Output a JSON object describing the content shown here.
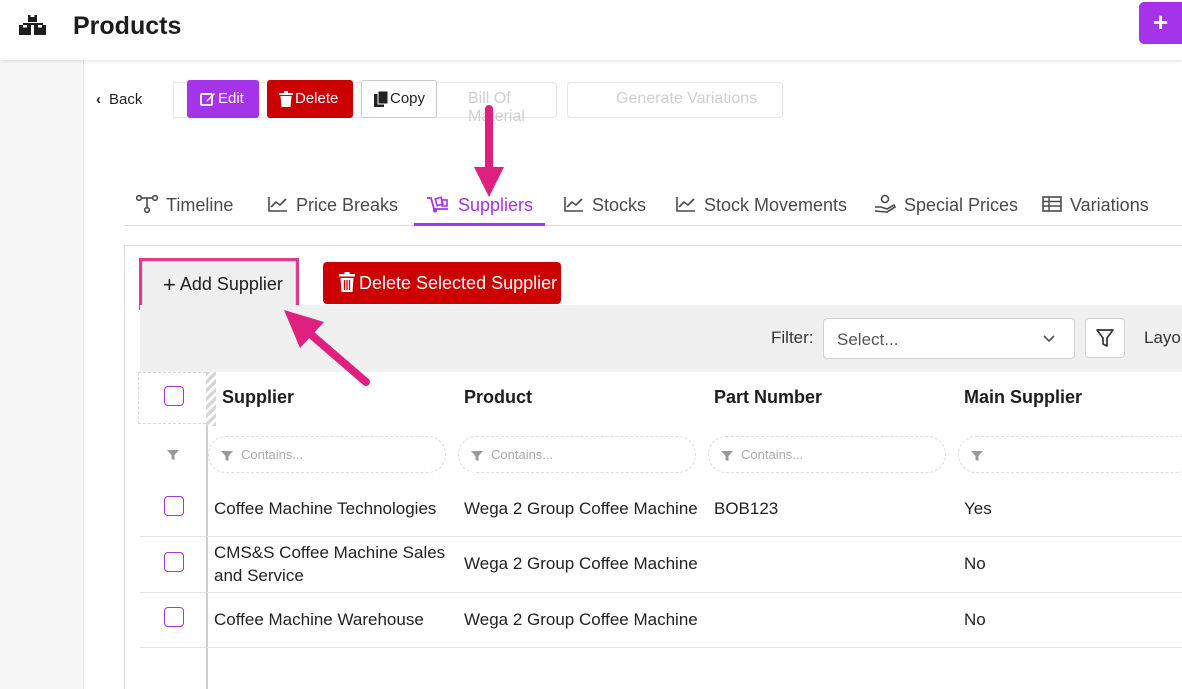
{
  "header": {
    "title": "Products",
    "add_button_label": "+ "
  },
  "toolbar": {
    "back_label": "Back",
    "edit_label": "Edit",
    "delete_label": "Delete",
    "copy_label": "Copy",
    "ghost_text_1": "Bill Of Material",
    "ghost_text_2": "Generate Variations"
  },
  "tabs": [
    {
      "label": "Timeline",
      "icon": "timeline-icon"
    },
    {
      "label": "Price Breaks",
      "icon": "chart-line-icon"
    },
    {
      "label": "Suppliers",
      "icon": "hand-truck-icon",
      "active": true
    },
    {
      "label": "Stocks",
      "icon": "chart-line-icon"
    },
    {
      "label": "Stock Movements",
      "icon": "chart-line-icon"
    },
    {
      "label": "Special Prices",
      "icon": "hand-coins-icon"
    },
    {
      "label": "Variations",
      "icon": "table-icon"
    }
  ],
  "suppliers_panel": {
    "add_label": "Add Supplier",
    "delete_selected_label": "Delete Selected Supplier",
    "filter_label": "Filter:",
    "filter_placeholder": "Select...",
    "layout_label": "Layou",
    "columns": [
      "Supplier",
      "Product",
      "Part Number",
      "Main Supplier"
    ],
    "column_filter_placeholder": "Contains...",
    "rows": [
      {
        "supplier": "Coffee Machine Technologies",
        "product": "Wega 2 Group Coffee Machine",
        "part_number": "BOB123",
        "main_supplier": "Yes"
      },
      {
        "supplier": "CMS&S Coffee Machine Sales and Service",
        "product": "Wega 2 Group Coffee Machine",
        "part_number": "",
        "main_supplier": "No"
      },
      {
        "supplier": "Coffee Machine Warehouse",
        "product": "Wega 2 Group Coffee Machine",
        "part_number": "",
        "main_supplier": "No"
      }
    ]
  },
  "colors": {
    "accent": "#a533ea",
    "danger": "#cc0000",
    "annotation": "#e23b8d"
  }
}
